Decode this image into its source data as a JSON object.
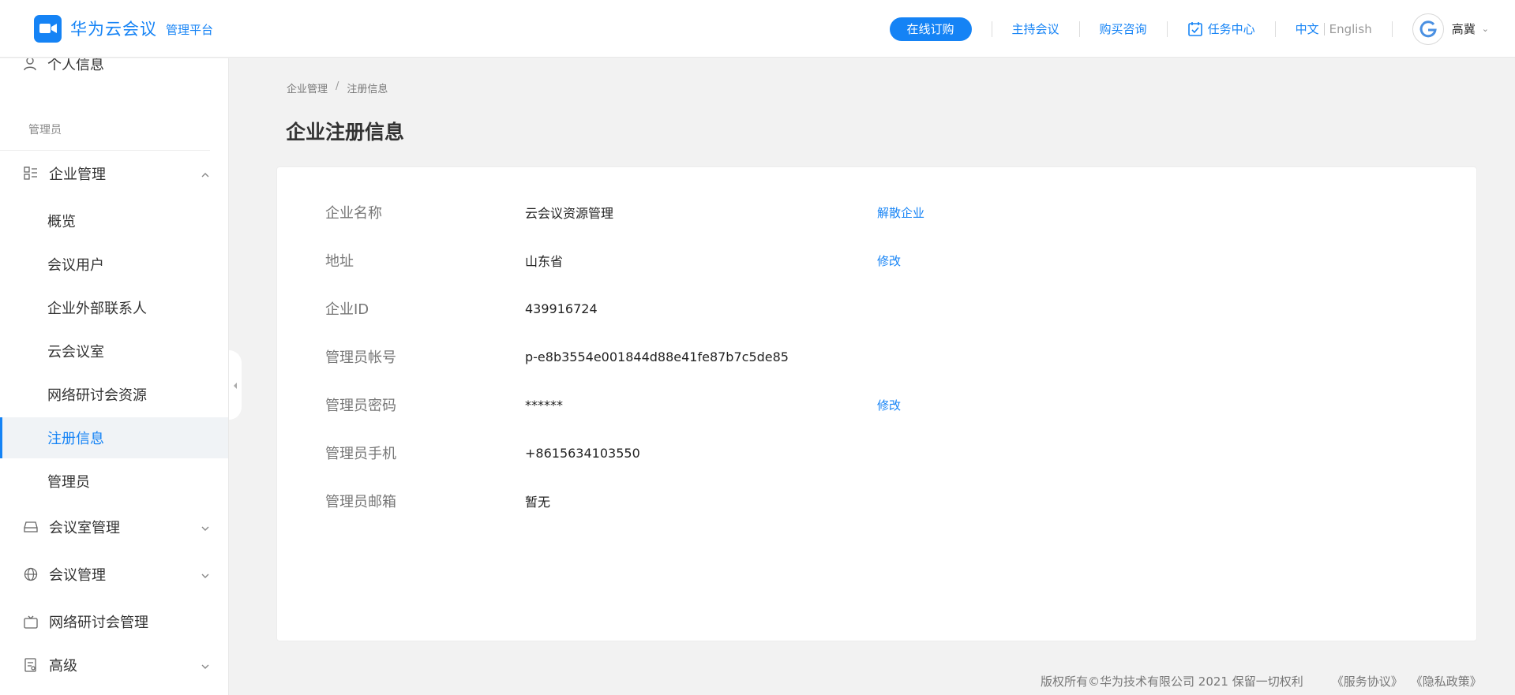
{
  "header": {
    "app_name": "华为云会议",
    "app_sub": "管理平台",
    "order_button": "在线订购",
    "links": {
      "host": "主持会议",
      "consult": "购买咨询",
      "tasks": "任务中心"
    },
    "lang_zh": "中文",
    "lang_en": "English",
    "user_name": "高冀",
    "colors": {
      "accent": "#1583f5"
    }
  },
  "sidebar": {
    "partial_item": "个人信息",
    "group_title": "管理员",
    "enterprise": {
      "label": "企业管理",
      "children": [
        "概览",
        "会议用户",
        "企业外部联系人",
        "云会议室",
        "网络研讨会资源",
        "注册信息",
        "管理员"
      ],
      "active_index": 5
    },
    "meeting_room_mgmt": "会议室管理",
    "meeting_mgmt": "会议管理",
    "webinar_mgmt": "网络研讨会管理",
    "advanced": "高级"
  },
  "breadcrumb": [
    "企业管理",
    "注册信息"
  ],
  "breadcrumb_sep": "/",
  "page_title": "企业注册信息",
  "info": [
    {
      "label": "企业名称",
      "value": "云会议资源管理",
      "action": "解散企业"
    },
    {
      "label": "地址",
      "value": "山东省",
      "action": "修改"
    },
    {
      "label": "企业ID",
      "value": "439916724",
      "action": ""
    },
    {
      "label": "管理员帐号",
      "value": "p-e8b3554e001844d88e41fe87b7c5de85",
      "action": ""
    },
    {
      "label": "管理员密码",
      "value": "******",
      "action": "修改"
    },
    {
      "label": "管理员手机",
      "value": "+8615634103550",
      "action": ""
    },
    {
      "label": "管理员邮箱",
      "value": "暂无",
      "action": ""
    }
  ],
  "footer": {
    "copyright": "版权所有©华为技术有限公司 2021 保留一切权利",
    "terms": "《服务协议》",
    "privacy": "《隐私政策》"
  }
}
